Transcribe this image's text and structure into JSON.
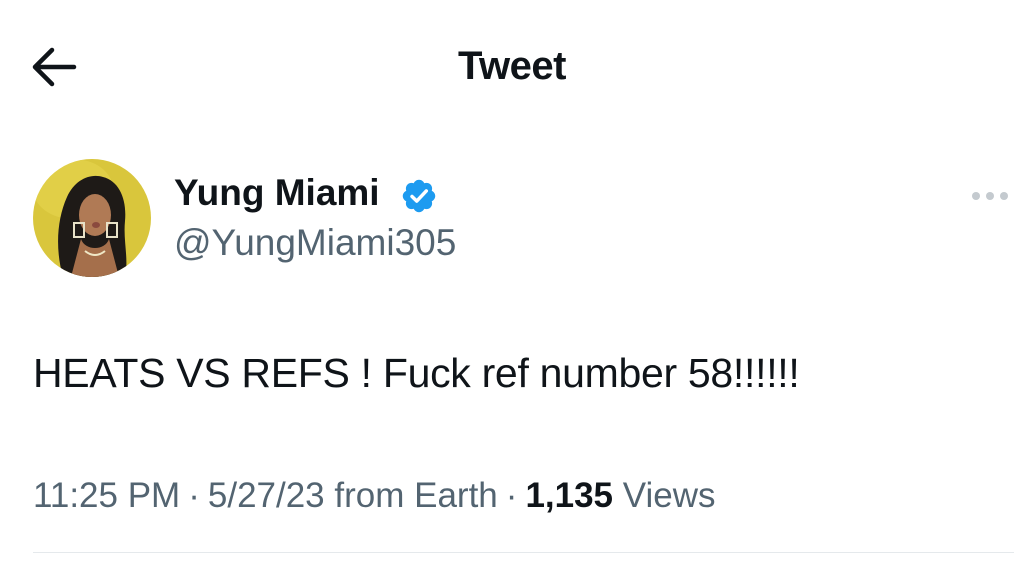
{
  "header": {
    "back_icon": "arrow-left-icon",
    "title": "Tweet"
  },
  "author": {
    "display_name": "Yung Miami",
    "handle": "@YungMiami305",
    "verified_icon": "verified-badge-icon",
    "verified_color": "#1d9bf0",
    "avatar_background": "#d9c63c"
  },
  "more_icon": "more-options-icon",
  "tweet": {
    "text": "HEATS VS REFS ! Fuck ref number 58!!!!!!",
    "time": "11:25 PM",
    "separator": "·",
    "date": "5/27/23",
    "source": "from Earth",
    "views_count": "1,135",
    "views_label": "Views"
  },
  "colors": {
    "text_primary": "#0f1419",
    "text_secondary": "#536471",
    "divider": "#e5e9ec"
  }
}
